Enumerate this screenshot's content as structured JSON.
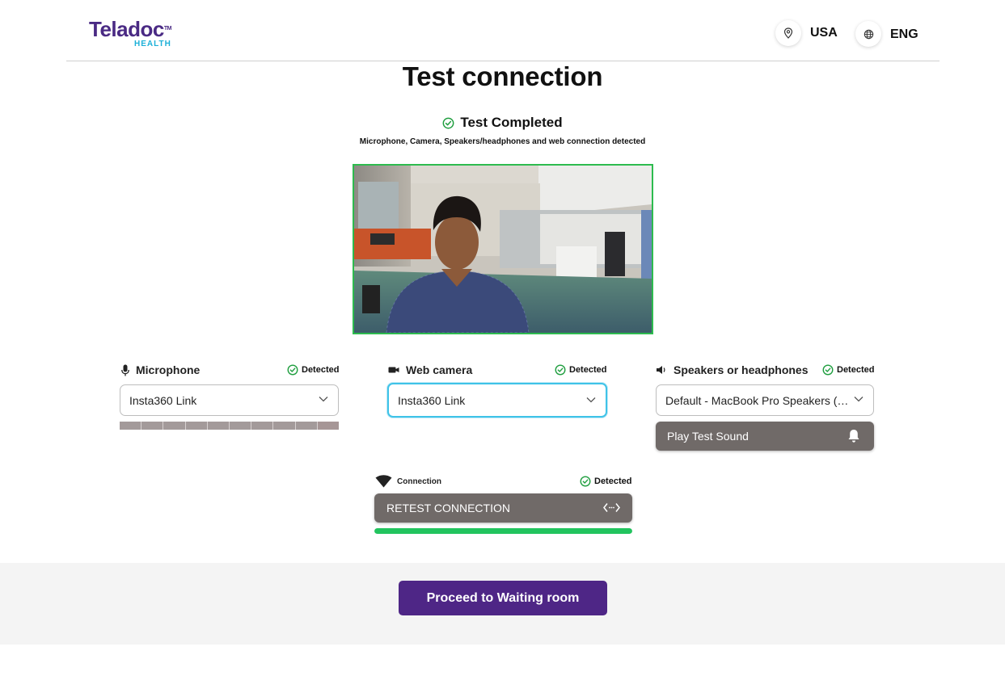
{
  "header": {
    "logo_word": "Teladoc",
    "logo_sub": "HEALTH",
    "region": "USA",
    "language": "ENG"
  },
  "title": "Test connection",
  "status": {
    "heading": "Test Completed",
    "subtitle": "Microphone, Camera, Speakers/headphones and web connection detected"
  },
  "devices": {
    "microphone": {
      "label": "Microphone",
      "status": "Detected",
      "value": "Insta360 Link",
      "level_segments": 10
    },
    "camera": {
      "label": "Web camera",
      "status": "Detected",
      "value": "Insta360 Link"
    },
    "speakers": {
      "label": "Speakers or headphones",
      "status": "Detected",
      "value": "Default - MacBook Pro Speakers (BuiltIn)",
      "test_button": "Play Test Sound"
    }
  },
  "connection": {
    "label": "Connection",
    "status": "Detected",
    "retest_button": "RETEST CONNECTION",
    "progress": 1.0
  },
  "proceed_button": "Proceed to Waiting room",
  "colors": {
    "brand_purple": "#4e2686",
    "brand_cyan": "#1cb0d8",
    "success_green": "#22c45e",
    "dark_button": "#706a68"
  }
}
